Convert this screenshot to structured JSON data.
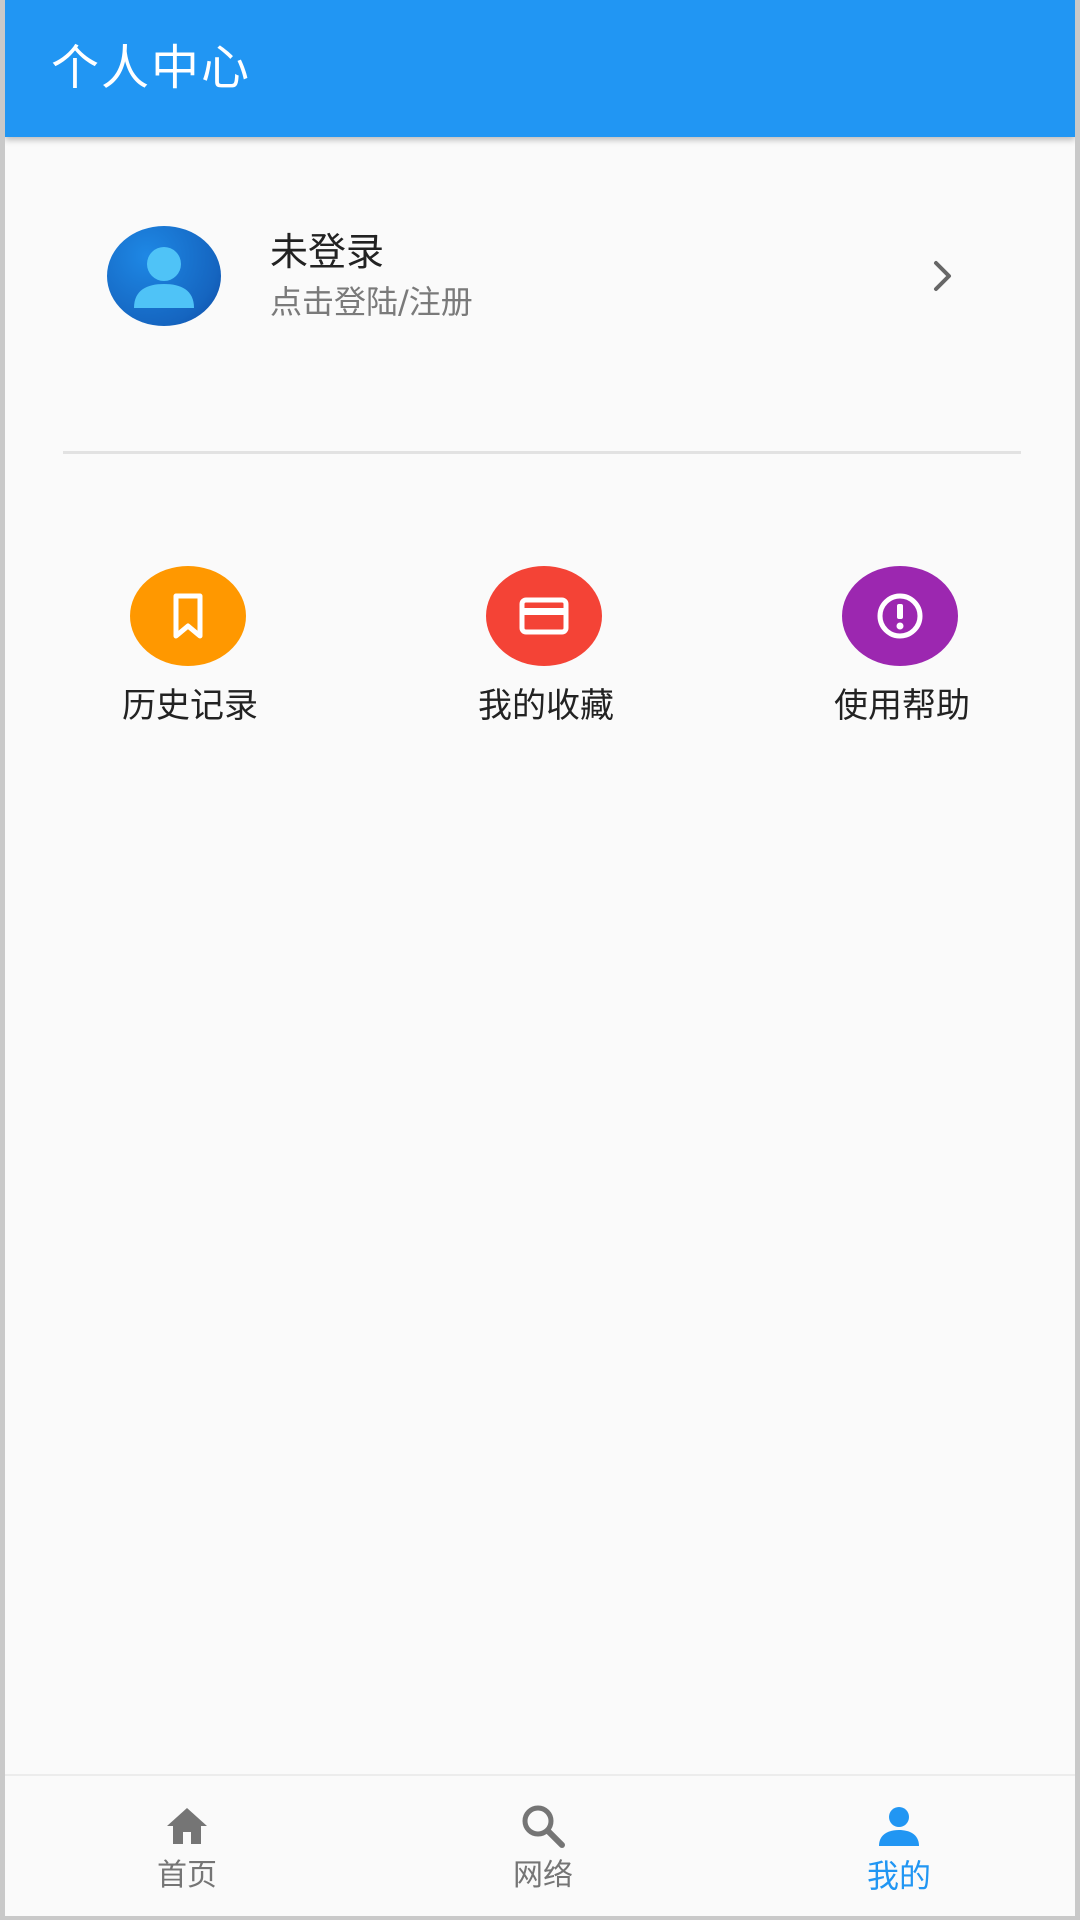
{
  "appbar": {
    "title": "个人中心"
  },
  "profile": {
    "name": "未登录",
    "subtitle": "点击登陆/注册",
    "avatar_icon": "person-icon",
    "chevron_icon": "chevron-right-icon"
  },
  "grid": [
    {
      "label": "历史记录",
      "icon": "bookmark-icon",
      "color": "#ff9800"
    },
    {
      "label": "我的收藏",
      "icon": "credit-card-icon",
      "color": "#f44336"
    },
    {
      "label": "使用帮助",
      "icon": "info-icon",
      "color": "#9c27b0"
    }
  ],
  "bottom_nav": [
    {
      "label": "首页",
      "icon": "home-icon",
      "active": false
    },
    {
      "label": "网络",
      "icon": "search-icon",
      "active": false
    },
    {
      "label": "我的",
      "icon": "person-icon",
      "active": true
    }
  ],
  "colors": {
    "primary": "#2196f3",
    "inactive": "#757575",
    "background": "#fafafa"
  }
}
